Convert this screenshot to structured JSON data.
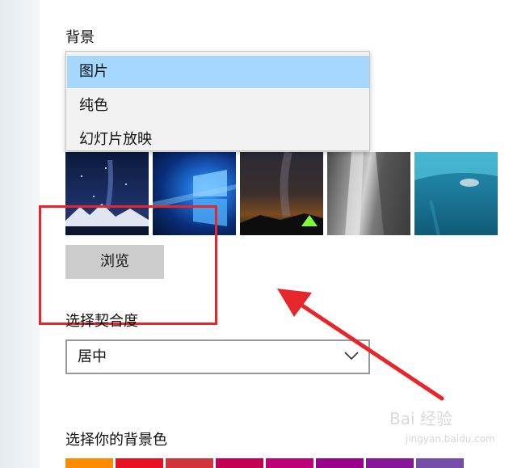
{
  "background": {
    "label": "背景",
    "dropdown_options": [
      "图片",
      "纯色",
      "幻灯片放映"
    ],
    "selected_index": 0,
    "thumbnails": [
      "night-sky-mountains",
      "windows-10-logo",
      "milky-way-tent",
      "rock-waterfall",
      "underwater-swimmer"
    ],
    "browse_label": "浏览"
  },
  "fit": {
    "label": "选择契合度",
    "value": "居中"
  },
  "color": {
    "label": "选择你的背景色",
    "swatches": [
      "#ff8c00",
      "#e81123",
      "#d13438",
      "#c30052",
      "#bf0077",
      "#9a0089",
      "#881798",
      "#744da9"
    ]
  },
  "annotation": {
    "highlight_color": "#e5262b",
    "arrow_color": "#e5262b"
  },
  "watermark": {
    "text": "Bai 经验",
    "url": "jingyan.baidu.com"
  }
}
